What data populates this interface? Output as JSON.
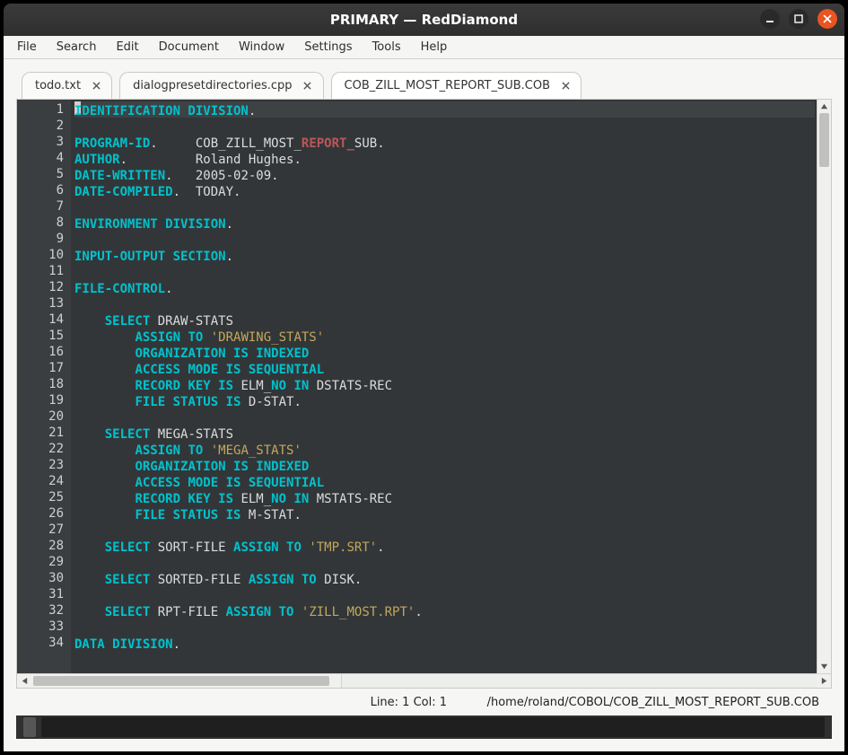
{
  "window": {
    "title": "PRIMARY — RedDiamond"
  },
  "window_controls": {
    "minimize_icon": "minimize-icon",
    "maximize_icon": "maximize-icon",
    "close_icon": "close-icon"
  },
  "menubar": {
    "items": [
      {
        "label": "File"
      },
      {
        "label": "Search"
      },
      {
        "label": "Edit"
      },
      {
        "label": "Document"
      },
      {
        "label": "Window"
      },
      {
        "label": "Settings"
      },
      {
        "label": "Tools"
      },
      {
        "label": "Help"
      }
    ]
  },
  "tabs": [
    {
      "label": "todo.txt",
      "active": false
    },
    {
      "label": "dialogpresetdirectories.cpp",
      "active": false
    },
    {
      "label": "COB_ZILL_MOST_REPORT_SUB.COB",
      "active": true
    }
  ],
  "editor": {
    "line_numbers": [
      "1",
      "2",
      "3",
      "4",
      "5",
      "6",
      "7",
      "8",
      "9",
      "10",
      "11",
      "12",
      "13",
      "14",
      "15",
      "16",
      "17",
      "18",
      "19",
      "20",
      "21",
      "22",
      "23",
      "24",
      "25",
      "26",
      "27",
      "28",
      "29",
      "30",
      "31",
      "32",
      "33",
      "34"
    ],
    "lines": [
      [
        {
          "c": "kw",
          "t": "IDENTIFICATION DIVISION"
        },
        {
          "c": "dot",
          "t": "."
        }
      ],
      [],
      [
        {
          "c": "kw",
          "t": "PROGRAM-ID"
        },
        {
          "c": "dot",
          "t": ".     "
        },
        {
          "c": "txt",
          "t": "COB_ZILL_MOST_"
        },
        {
          "c": "id",
          "t": "REPORT_"
        },
        {
          "c": "txt",
          "t": "SUB."
        }
      ],
      [
        {
          "c": "kw",
          "t": "AUTHOR"
        },
        {
          "c": "dot",
          "t": ".         "
        },
        {
          "c": "txt",
          "t": "Roland Hughes."
        }
      ],
      [
        {
          "c": "kw",
          "t": "DATE-WRITTEN"
        },
        {
          "c": "dot",
          "t": ".   "
        },
        {
          "c": "txt",
          "t": "2005-02-09."
        }
      ],
      [
        {
          "c": "kw",
          "t": "DATE-COMPILED"
        },
        {
          "c": "dot",
          "t": ".  "
        },
        {
          "c": "txt",
          "t": "TODAY."
        }
      ],
      [],
      [
        {
          "c": "kw",
          "t": "ENVIRONMENT DIVISION"
        },
        {
          "c": "dot",
          "t": "."
        }
      ],
      [],
      [
        {
          "c": "kw",
          "t": "INPUT-OUTPUT SECTION"
        },
        {
          "c": "dot",
          "t": "."
        }
      ],
      [],
      [
        {
          "c": "kw",
          "t": "FILE-CONTROL"
        },
        {
          "c": "dot",
          "t": "."
        }
      ],
      [],
      [
        {
          "c": "txt",
          "t": "    "
        },
        {
          "c": "kw2",
          "t": "SELECT"
        },
        {
          "c": "txt",
          "t": " DRAW-STATS"
        }
      ],
      [
        {
          "c": "txt",
          "t": "        "
        },
        {
          "c": "kw2",
          "t": "ASSIGN TO"
        },
        {
          "c": "txt",
          "t": " "
        },
        {
          "c": "str",
          "t": "'DRAWING_STATS'"
        }
      ],
      [
        {
          "c": "txt",
          "t": "        "
        },
        {
          "c": "kw2",
          "t": "ORGANIZATION IS INDEXED"
        }
      ],
      [
        {
          "c": "txt",
          "t": "        "
        },
        {
          "c": "kw2",
          "t": "ACCESS MODE IS SEQUENTIAL"
        }
      ],
      [
        {
          "c": "txt",
          "t": "        "
        },
        {
          "c": "kw2",
          "t": "RECORD KEY IS"
        },
        {
          "c": "txt",
          "t": " ELM_"
        },
        {
          "c": "kw2",
          "t": "NO IN"
        },
        {
          "c": "txt",
          "t": " DSTATS-REC"
        }
      ],
      [
        {
          "c": "txt",
          "t": "        "
        },
        {
          "c": "kw2",
          "t": "FILE STATUS IS"
        },
        {
          "c": "txt",
          "t": " D-STAT."
        }
      ],
      [],
      [
        {
          "c": "txt",
          "t": "    "
        },
        {
          "c": "kw2",
          "t": "SELECT"
        },
        {
          "c": "txt",
          "t": " MEGA-STATS"
        }
      ],
      [
        {
          "c": "txt",
          "t": "        "
        },
        {
          "c": "kw2",
          "t": "ASSIGN TO"
        },
        {
          "c": "txt",
          "t": " "
        },
        {
          "c": "str",
          "t": "'MEGA_STATS'"
        }
      ],
      [
        {
          "c": "txt",
          "t": "        "
        },
        {
          "c": "kw2",
          "t": "ORGANIZATION IS INDEXED"
        }
      ],
      [
        {
          "c": "txt",
          "t": "        "
        },
        {
          "c": "kw2",
          "t": "ACCESS MODE IS SEQUENTIAL"
        }
      ],
      [
        {
          "c": "txt",
          "t": "        "
        },
        {
          "c": "kw2",
          "t": "RECORD KEY IS"
        },
        {
          "c": "txt",
          "t": " ELM_"
        },
        {
          "c": "kw2",
          "t": "NO IN"
        },
        {
          "c": "txt",
          "t": " MSTATS-REC"
        }
      ],
      [
        {
          "c": "txt",
          "t": "        "
        },
        {
          "c": "kw2",
          "t": "FILE STATUS IS"
        },
        {
          "c": "txt",
          "t": " M-STAT."
        }
      ],
      [],
      [
        {
          "c": "txt",
          "t": "    "
        },
        {
          "c": "kw2",
          "t": "SELECT"
        },
        {
          "c": "txt",
          "t": " SORT-FILE "
        },
        {
          "c": "kw2",
          "t": "ASSIGN TO"
        },
        {
          "c": "txt",
          "t": " "
        },
        {
          "c": "str",
          "t": "'TMP.SRT'"
        },
        {
          "c": "dot",
          "t": "."
        }
      ],
      [],
      [
        {
          "c": "txt",
          "t": "    "
        },
        {
          "c": "kw2",
          "t": "SELECT"
        },
        {
          "c": "txt",
          "t": " SORTED-FILE "
        },
        {
          "c": "kw2",
          "t": "ASSIGN TO"
        },
        {
          "c": "txt",
          "t": " DISK."
        }
      ],
      [],
      [
        {
          "c": "txt",
          "t": "    "
        },
        {
          "c": "kw2",
          "t": "SELECT"
        },
        {
          "c": "txt",
          "t": " RPT-FILE "
        },
        {
          "c": "kw2",
          "t": "ASSIGN TO"
        },
        {
          "c": "txt",
          "t": " "
        },
        {
          "c": "str",
          "t": "'ZILL_MOST.RPT'"
        },
        {
          "c": "dot",
          "t": "."
        }
      ],
      [],
      [
        {
          "c": "kw",
          "t": "DATA DIVISION"
        },
        {
          "c": "dot",
          "t": "."
        }
      ]
    ]
  },
  "statusbar": {
    "position": "Line: 1  Col: 1",
    "file_path": "/home/roland/COBOL/COB_ZILL_MOST_REPORT_SUB.COB"
  }
}
